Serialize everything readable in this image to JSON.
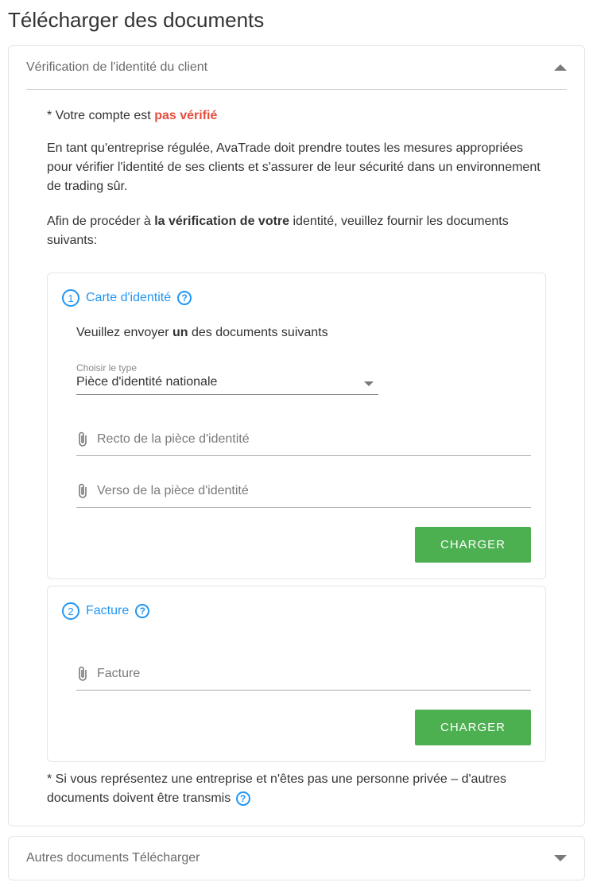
{
  "page": {
    "title": "Télécharger des documents"
  },
  "panel1": {
    "title": "Vérification de l'identité du client",
    "status_prefix": "* Votre compte est ",
    "status_value": "pas vérifié",
    "description": "En tant qu'entreprise régulée, AvaTrade doit prendre toutes les mesures appropriées pour vérifier l'identité de ses clients et s'assurer de leur sécurité dans un environnement de trading sûr.",
    "instruction_prefix": "Afin de procéder à ",
    "instruction_bold": "la vérification de votre",
    "instruction_suffix": " identité, veuillez fournir les documents suivants:"
  },
  "step1": {
    "number": "1",
    "title": "Carte d'identité",
    "instruction_prefix": "Veuillez envoyer ",
    "instruction_bold": "un",
    "instruction_suffix": " des documents suivants",
    "select_label": "Choisir le type",
    "select_value": "Pièce d'identité nationale",
    "upload1": "Recto de la pièce d'identité",
    "upload2": "Verso de la pièce d'identité",
    "button": "CHARGER"
  },
  "step2": {
    "number": "2",
    "title": "Facture",
    "upload1": "Facture",
    "button": "CHARGER"
  },
  "footer": {
    "note": "* Si vous représentez une entreprise et n'êtes pas une personne privée – d'autres documents doivent être transmis"
  },
  "panel2": {
    "title": "Autres documents Télécharger"
  }
}
